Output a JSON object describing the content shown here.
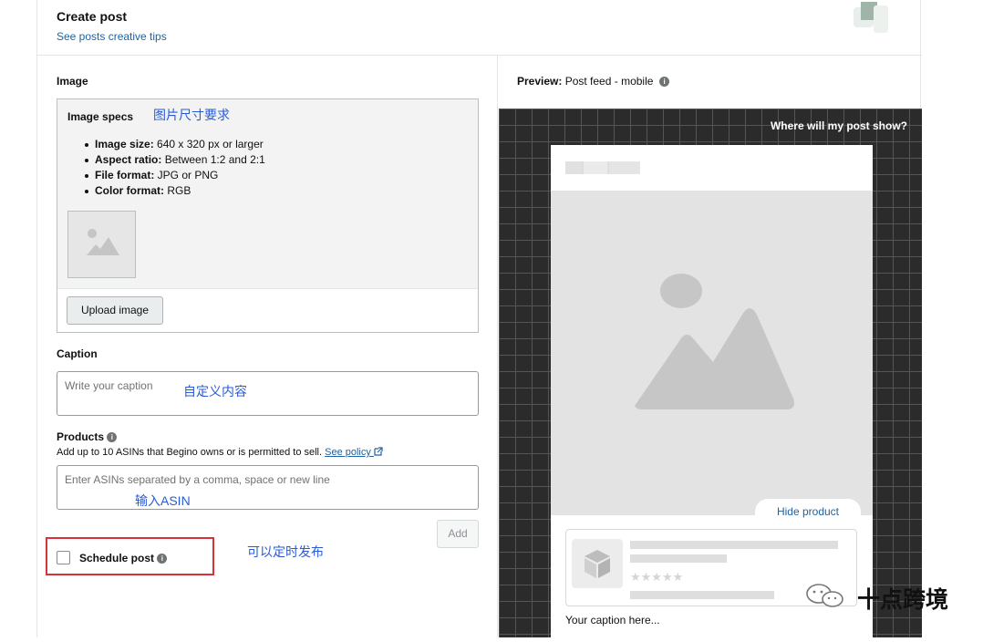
{
  "header": {
    "title": "Create post",
    "tips_link": "See posts creative tips"
  },
  "image_section": {
    "label": "Image",
    "specs_title": "Image specs",
    "annotation_cn": "图片尺寸要求",
    "specs": [
      {
        "key": "Image size:",
        "value": " 640 x 320 px or larger"
      },
      {
        "key": "Aspect ratio:",
        "value": " Between 1:2 and 2:1"
      },
      {
        "key": "File format:",
        "value": " JPG or PNG"
      },
      {
        "key": "Color format:",
        "value": " RGB"
      }
    ],
    "upload_button": "Upload image"
  },
  "caption_section": {
    "label": "Caption",
    "placeholder": "Write your caption",
    "annotation_cn": "自定义内容"
  },
  "products_section": {
    "label": "Products",
    "help_text": "Add up to 10 ASINs that Begino owns or is permitted to sell.",
    "policy_link": "See policy",
    "placeholder": "Enter ASINs separated by a comma, space or new line",
    "annotation_cn": "输入ASIN",
    "add_button": "Add"
  },
  "schedule": {
    "label": "Schedule post",
    "checked": false,
    "annotation_cn": "可以定时发布"
  },
  "preview": {
    "label": "Preview:",
    "mode": "Post feed - mobile",
    "where_link": "Where will my post show?",
    "hide_product": "Hide product",
    "caption_placeholder": "Your caption here...",
    "stars": "★★★★★"
  },
  "watermark": {
    "text": "十点跨境"
  },
  "colors": {
    "link": "#2162a1",
    "annotation": "#2a5bd7",
    "highlight_box": "#d9323a",
    "grid_bg": "#2b2b2b"
  }
}
